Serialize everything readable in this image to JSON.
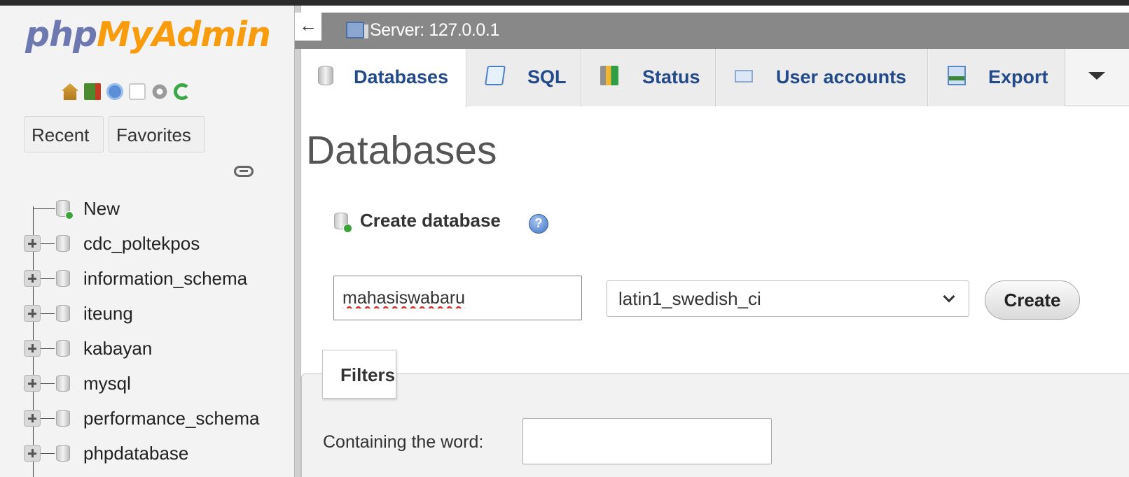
{
  "nav": {
    "logo_php": "php",
    "logo_myadmin": "MyAdmin",
    "icons": [
      "home-icon",
      "exit-icon",
      "docs-icon",
      "documentation-icon",
      "settings-icon",
      "reload-icon"
    ],
    "tabs": {
      "recent": "Recent",
      "favorites": "Favorites"
    },
    "tree": [
      {
        "label": "New",
        "icon": "new-database-icon"
      },
      {
        "label": "cdc_poltekpos",
        "icon": "database-icon"
      },
      {
        "label": "information_schema",
        "icon": "database-icon"
      },
      {
        "label": "iteung",
        "icon": "database-icon"
      },
      {
        "label": "kabayan",
        "icon": "database-icon"
      },
      {
        "label": "mysql",
        "icon": "database-icon"
      },
      {
        "label": "performance_schema",
        "icon": "database-icon"
      },
      {
        "label": "phpdatabase",
        "icon": "database-icon"
      }
    ]
  },
  "server": {
    "collapse": "←",
    "label": "Server: 127.0.0.1"
  },
  "tabs": [
    {
      "label": "Databases",
      "icon": "database-icon",
      "active": true
    },
    {
      "label": "SQL",
      "icon": "sql-icon",
      "active": false
    },
    {
      "label": "Status",
      "icon": "status-icon",
      "active": false
    },
    {
      "label": "User accounts",
      "icon": "user-accounts-icon",
      "active": false
    },
    {
      "label": "Export",
      "icon": "export-icon",
      "active": false
    }
  ],
  "main": {
    "title": "Databases",
    "create": {
      "title": "Create database",
      "db_name_value": "mahasiswabaru",
      "collation_selected": "latin1_swedish_ci",
      "button": "Create"
    },
    "filters": {
      "legend": "Filters",
      "label": "Containing the word:",
      "value": ""
    }
  },
  "colors": {
    "logo_php": "#6c78af",
    "logo_myadmin": "#f89c0e",
    "tab_text": "#234a89",
    "server_bar": "#888888"
  }
}
